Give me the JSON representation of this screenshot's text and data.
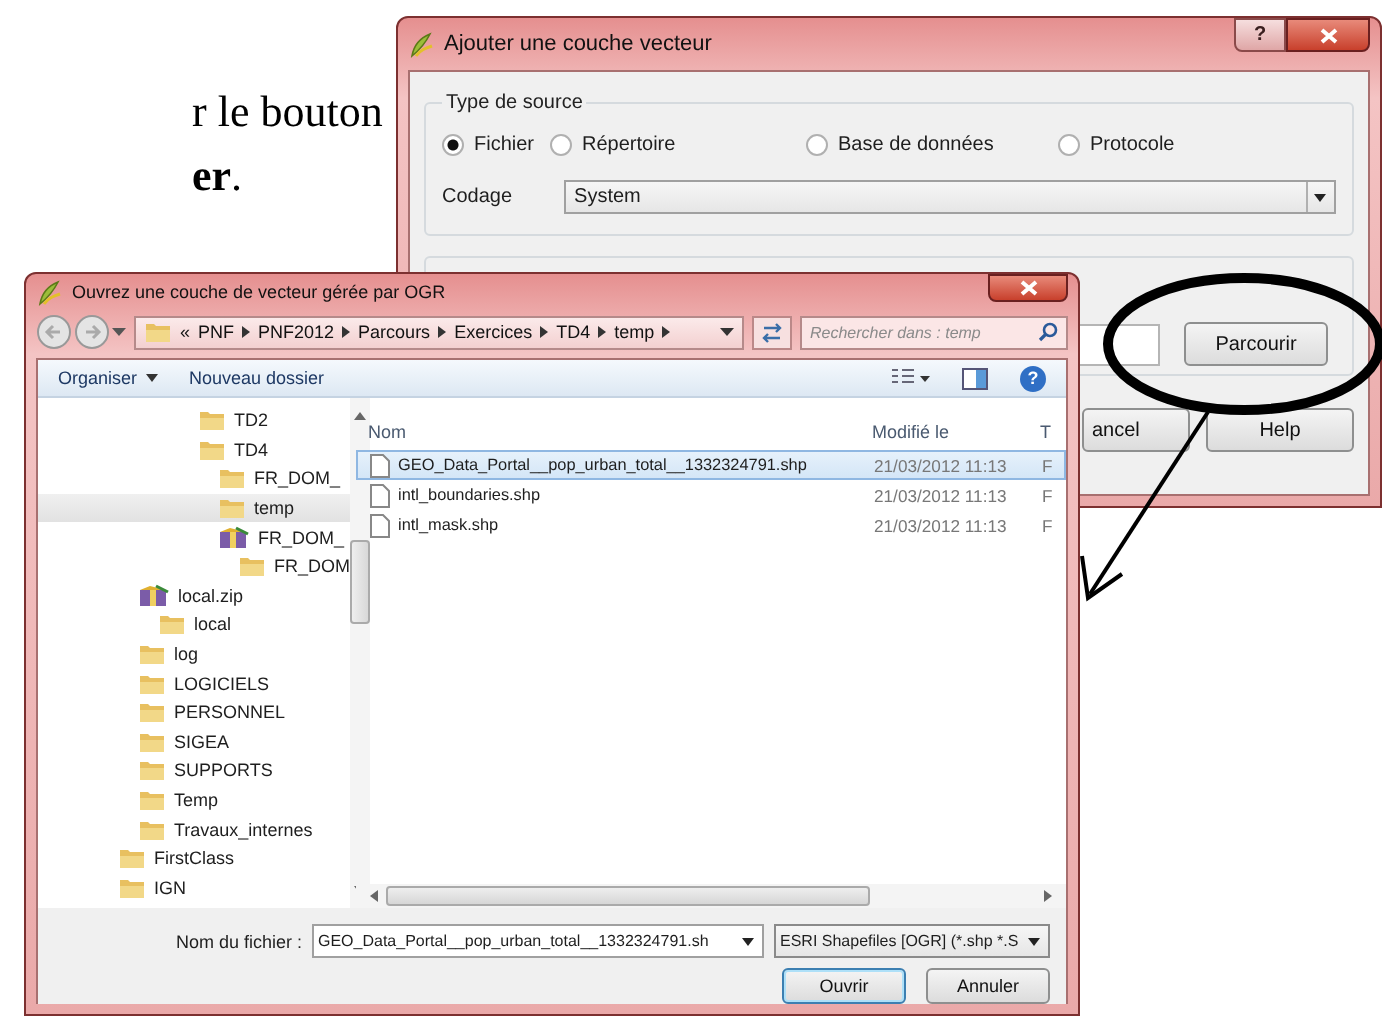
{
  "document_text": {
    "line_1": "r le bouton",
    "line_2": "**er**."
  },
  "vector_dialog": {
    "title": "Ajouter une couche vecteur",
    "help_glyph": "?",
    "source_group": {
      "title": "Type de source",
      "options": [
        {
          "label": "Fichier",
          "selected": true
        },
        {
          "label": "Répertoire",
          "selected": false
        },
        {
          "label": "Base de données",
          "selected": false
        },
        {
          "label": "Protocole",
          "selected": false
        }
      ]
    },
    "encoding": {
      "label": "Codage",
      "value": "System"
    },
    "browse_button": "Parcourir",
    "buttons": [
      "ancel",
      "Help"
    ]
  },
  "file_dialog": {
    "title": "Ouvrez une couche de vecteur gérée par OGR",
    "breadcrumb_overflow": "«",
    "breadcrumb": [
      "PNF",
      "PNF2012",
      "Parcours",
      "Exercices",
      "TD4",
      "temp"
    ],
    "search": {
      "placeholder": "Rechercher dans : temp"
    },
    "toolbar": {
      "organize": "Organiser",
      "new_folder": "Nouveau dossier",
      "help_glyph": "?"
    },
    "tree": [
      {
        "children": [
          {
            "children": [
              {
                "children": [
                  {
                    "children": [
                      {
                        "label": "TD2",
                        "kind": "folder",
                        "selected": false
                      },
                      {
                        "label": "TD4",
                        "kind": "folder",
                        "selected": false,
                        "children": [
                          {
                            "label": "FR_DOM_",
                            "kind": "folder",
                            "selected": false
                          },
                          {
                            "label": "temp",
                            "kind": "folder",
                            "selected": true
                          },
                          {
                            "label": "FR_DOM_",
                            "kind": "zip",
                            "selected": false,
                            "children": [
                              {
                                "label": "FR_DOM",
                                "kind": "folder",
                                "selected": false
                              }
                            ]
                          }
                        ]
                      }
                    ]
                  }
                ]
              }
            ]
          },
          {
            "label": "local.zip",
            "kind": "zip",
            "selected": false,
            "children": [
              {
                "label": "local",
                "kind": "folder",
                "selected": false
              }
            ]
          },
          {
            "label": "log",
            "kind": "folder",
            "selected": false
          },
          {
            "label": "LOGICIELS",
            "kind": "folder",
            "selected": false
          },
          {
            "label": "PERSONNEL",
            "kind": "folder",
            "selected": false
          },
          {
            "label": "SIGEA",
            "kind": "folder",
            "selected": false
          },
          {
            "label": "SUPPORTS",
            "kind": "folder",
            "selected": false
          },
          {
            "label": "Temp",
            "kind": "folder",
            "selected": false
          },
          {
            "label": "Travaux_internes",
            "kind": "folder",
            "selected": false
          }
        ]
      },
      {
        "label": "FirstClass",
        "kind": "folder",
        "selected": false
      },
      {
        "label": "IGN",
        "kind": "folder",
        "selected": false
      }
    ],
    "columns": [
      "Nom",
      "Modifié le",
      "T"
    ],
    "files": [
      {
        "name": "GEO_Data_Portal__pop_urban_total__1332324791.shp",
        "modified": "21/03/2012 11:13",
        "column_3": "F",
        "selected": true
      },
      {
        "name": "intl_boundaries.shp",
        "modified": "21/03/2012 11:13",
        "column_3": "F",
        "selected": false
      },
      {
        "name": "intl_mask.shp",
        "modified": "21/03/2012 11:13",
        "column_3": "F",
        "selected": false
      }
    ],
    "filename": {
      "label": "Nom du fichier :",
      "value": "GEO_Data_Portal__pop_urban_total__1332324791.sh"
    },
    "filter": "ESRI Shapefiles [OGR] (*.shp *.S",
    "buttons": [
      "Ouvrir",
      "Annuler"
    ]
  }
}
